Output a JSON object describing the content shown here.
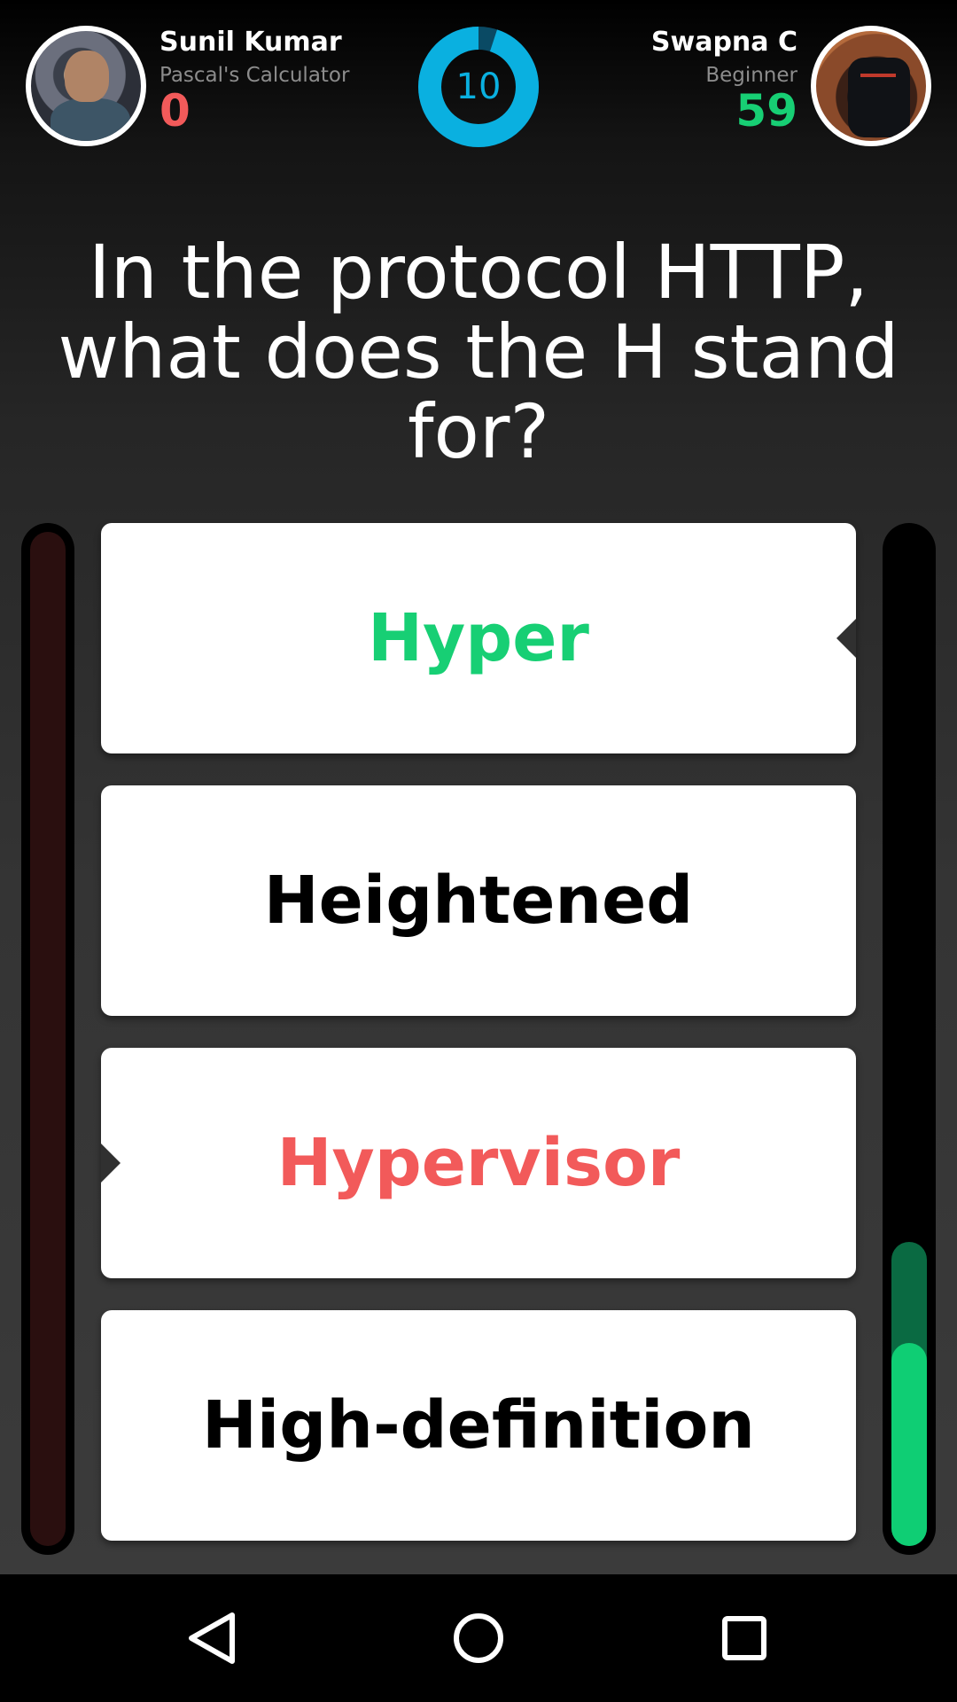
{
  "player_left": {
    "name": "Sunil Kumar",
    "rank": "Pascal's Calculator",
    "score": "0",
    "score_color": "#f25a5a"
  },
  "player_right": {
    "name": "Swapna C",
    "rank": "Beginner",
    "score": "59",
    "score_color": "#17cf74"
  },
  "timer": {
    "seconds": "10",
    "remaining_fraction": 0.95,
    "color": "#0ab0e0"
  },
  "question": "In the protocol HTTP, what does the H stand for?",
  "answers": [
    {
      "label": "Hyper",
      "state": "correct",
      "selected_by": "right"
    },
    {
      "label": "Heightened",
      "state": "neutral"
    },
    {
      "label": "Hypervisor",
      "state": "wrong",
      "selected_by": "left"
    },
    {
      "label": "High-definition",
      "state": "neutral"
    }
  ],
  "score_bars": {
    "left_fraction": 0.0,
    "right_fraction_total": 0.3,
    "right_fraction_last": 0.2,
    "left_color": "#2a0f0f",
    "right_color": "#0fce74"
  },
  "navbar": {
    "icons": [
      "back-icon",
      "home-icon",
      "recents-icon"
    ]
  }
}
